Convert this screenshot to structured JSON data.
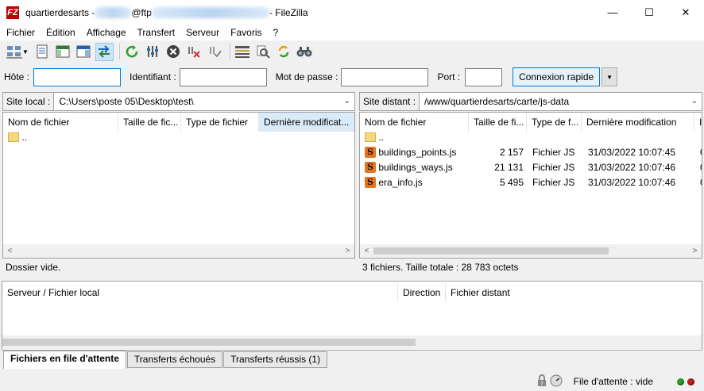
{
  "window": {
    "title_prefix": "quartierdesarts - ",
    "title_mid": "@ftp",
    "title_suffix": " - FileZilla",
    "app_icon_letter": "FZ",
    "minimize_glyph": "—",
    "maximize_glyph": "☐",
    "close_glyph": "✕"
  },
  "menu": [
    "Fichier",
    "Édition",
    "Affichage",
    "Transfert",
    "Serveur",
    "Favoris",
    "?"
  ],
  "quickconnect": {
    "host_label": "Hôte :",
    "user_label": "Identifiant :",
    "pass_label": "Mot de passe :",
    "port_label": "Port :",
    "host_value": "",
    "user_value": "",
    "pass_value": "",
    "port_value": "",
    "connect_label": "Connexion rapide"
  },
  "local": {
    "site_label": "Site local :",
    "path": "C:\\Users\\poste 05\\Desktop\\test\\",
    "columns": [
      "Nom de fichier",
      "Taille de fic...",
      "Type de fichier",
      "Dernière modificat..."
    ],
    "rows": [
      {
        "name": ".."
      }
    ],
    "status": "Dossier vide."
  },
  "remote": {
    "site_label": "Site distant :",
    "path": "/www/quartierdesarts/carte/js-data",
    "columns": [
      "Nom de fichier",
      "Taille de fi...",
      "Type de f...",
      "Dernière modification",
      "I"
    ],
    "rows": [
      {
        "name": "..",
        "size": "",
        "type": "",
        "modified": "",
        "extra": ""
      },
      {
        "name": "buildings_points.js",
        "size": "2 157",
        "type": "Fichier JS",
        "modified": "31/03/2022 10:07:45",
        "extra": "0"
      },
      {
        "name": "buildings_ways.js",
        "size": "21 131",
        "type": "Fichier JS",
        "modified": "31/03/2022 10:07:46",
        "extra": "0"
      },
      {
        "name": "era_info.js",
        "size": "5 495",
        "type": "Fichier JS",
        "modified": "31/03/2022 10:07:46",
        "extra": "0"
      }
    ],
    "status": "3 fichiers. Taille totale : 28 783 octets"
  },
  "queue": {
    "columns": [
      "Serveur / Fichier local",
      "Direction",
      "Fichier distant"
    ]
  },
  "tabs": [
    "Fichiers en file d'attente",
    "Transferts échoués",
    "Transferts réussis (1)"
  ],
  "statusbar": {
    "queue_text": "File d'attente : vide"
  },
  "colors": {
    "accent": "#0078d7",
    "selected_header": "#d9ebf9",
    "led_green": "#2e9e2e",
    "led_red": "#c81e1e"
  }
}
